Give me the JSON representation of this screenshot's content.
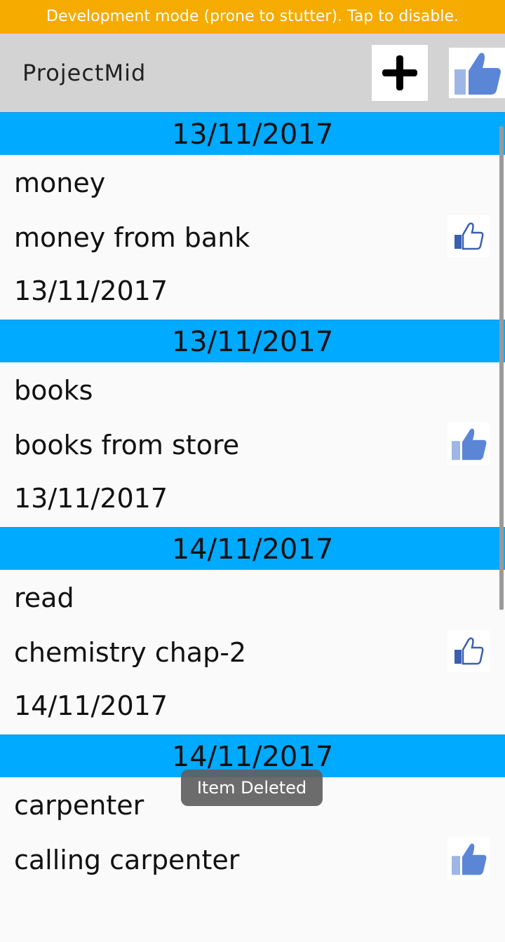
{
  "dev_banner": {
    "text": "Development mode (prone to stutter). Tap to disable."
  },
  "toolbar": {
    "title": "ProjectMid",
    "add_icon": "plus-icon",
    "like_icon": "thumbs-up-icon"
  },
  "colors": {
    "banner": "#f6ab00",
    "toolbar": "#d3d3d3",
    "section_header": "#00aaff",
    "like_blue": "#5b86d6"
  },
  "sections": [
    {
      "date": "13/11/2017",
      "item": {
        "title": "money",
        "description": "money from bank",
        "date": "13/11/2017",
        "liked": false
      }
    },
    {
      "date": "13/11/2017",
      "item": {
        "title": "books",
        "description": "books from store",
        "date": "13/11/2017",
        "liked": true
      }
    },
    {
      "date": "14/11/2017",
      "item": {
        "title": "read",
        "description": "chemistry chap-2",
        "date": "14/11/2017",
        "liked": false
      }
    },
    {
      "date": "14/11/2017",
      "item": {
        "title": "carpenter",
        "description": "calling carpenter",
        "date": "",
        "liked": true
      }
    }
  ],
  "toast": {
    "text": "Item Deleted"
  }
}
